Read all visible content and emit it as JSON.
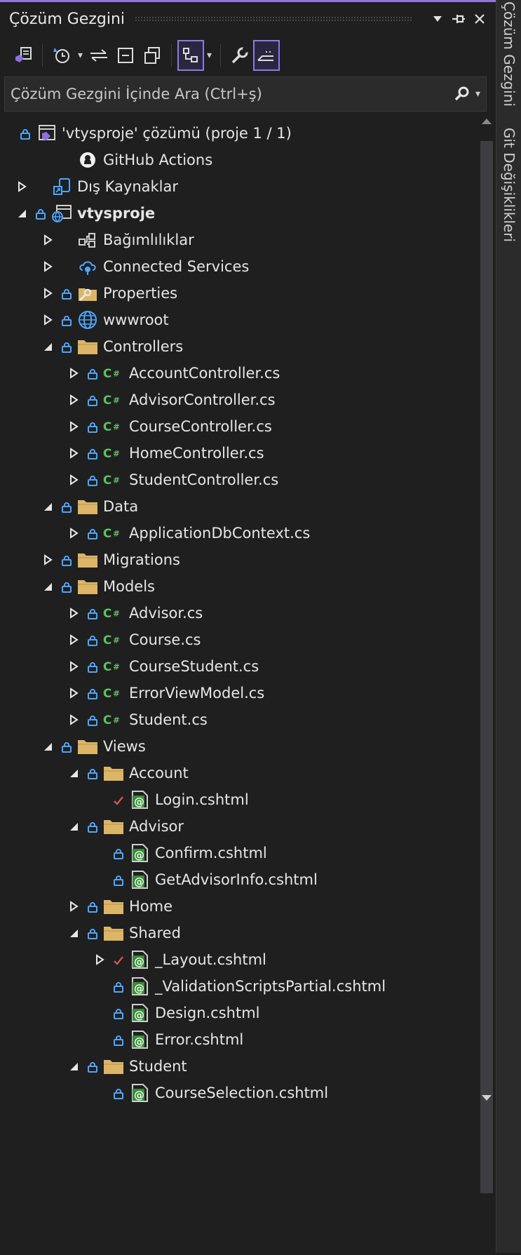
{
  "panel": {
    "title": "Çözüm Gezgini",
    "accent_color": "#9277d8",
    "title_icons": [
      "dropdown-icon",
      "pin-icon",
      "close-icon"
    ]
  },
  "toolbar": {
    "items": [
      "switch-views-icon",
      "history-icon",
      "sync-icon",
      "collapse-all-icon",
      "show-all-files-icon",
      "preview-icon",
      "properties-icon",
      "pending-changes-filter-icon"
    ]
  },
  "search": {
    "placeholder": "Çözüm Gezgini İçinde Ara (Ctrl+ş)"
  },
  "side_tabs": [
    "Çözüm Gezgini",
    "Git Değişiklikleri"
  ],
  "tree": [
    {
      "label": "'vtysproje' çözümü (proje 1 / 1)",
      "depth": 0,
      "expander": "none",
      "lock": true,
      "icon": "solution-icon"
    },
    {
      "label": "GitHub Actions",
      "depth": 1,
      "expander": "none",
      "lock": false,
      "icon": "github-icon"
    },
    {
      "label": "Dış Kaynaklar",
      "depth": 0,
      "expander": "collapsed",
      "lock": false,
      "icon": "external-sources-icon"
    },
    {
      "label": "vtysproje",
      "depth": 0,
      "expander": "expanded",
      "lock": true,
      "icon": "web-project-icon",
      "bold": true
    },
    {
      "label": "Bağımlılıklar",
      "depth": 1,
      "expander": "collapsed",
      "lock": false,
      "icon": "dependencies-icon"
    },
    {
      "label": "Connected Services",
      "depth": 1,
      "expander": "collapsed",
      "lock": false,
      "icon": "connected-services-icon"
    },
    {
      "label": "Properties",
      "depth": 1,
      "expander": "collapsed",
      "lock": true,
      "icon": "properties-folder-icon"
    },
    {
      "label": "wwwroot",
      "depth": 1,
      "expander": "collapsed",
      "lock": true,
      "icon": "globe-icon"
    },
    {
      "label": "Controllers",
      "depth": 1,
      "expander": "expanded",
      "lock": true,
      "icon": "folder-icon"
    },
    {
      "label": "AccountController.cs",
      "depth": 2,
      "expander": "collapsed",
      "lock": true,
      "icon": "csharp-icon"
    },
    {
      "label": "AdvisorController.cs",
      "depth": 2,
      "expander": "collapsed",
      "lock": true,
      "icon": "csharp-icon"
    },
    {
      "label": "CourseController.cs",
      "depth": 2,
      "expander": "collapsed",
      "lock": true,
      "icon": "csharp-icon"
    },
    {
      "label": "HomeController.cs",
      "depth": 2,
      "expander": "collapsed",
      "lock": true,
      "icon": "csharp-icon"
    },
    {
      "label": "StudentController.cs",
      "depth": 2,
      "expander": "collapsed",
      "lock": true,
      "icon": "csharp-icon"
    },
    {
      "label": "Data",
      "depth": 1,
      "expander": "expanded",
      "lock": true,
      "icon": "folder-icon"
    },
    {
      "label": "ApplicationDbContext.cs",
      "depth": 2,
      "expander": "collapsed",
      "lock": true,
      "icon": "csharp-icon"
    },
    {
      "label": "Migrations",
      "depth": 1,
      "expander": "collapsed",
      "lock": true,
      "icon": "folder-icon"
    },
    {
      "label": "Models",
      "depth": 1,
      "expander": "expanded",
      "lock": true,
      "icon": "folder-icon"
    },
    {
      "label": "Advisor.cs",
      "depth": 2,
      "expander": "collapsed",
      "lock": true,
      "icon": "csharp-icon"
    },
    {
      "label": "Course.cs",
      "depth": 2,
      "expander": "collapsed",
      "lock": true,
      "icon": "csharp-icon"
    },
    {
      "label": "CourseStudent.cs",
      "depth": 2,
      "expander": "collapsed",
      "lock": true,
      "icon": "csharp-icon"
    },
    {
      "label": "ErrorViewModel.cs",
      "depth": 2,
      "expander": "collapsed",
      "lock": true,
      "icon": "csharp-icon"
    },
    {
      "label": "Student.cs",
      "depth": 2,
      "expander": "collapsed",
      "lock": true,
      "icon": "csharp-icon"
    },
    {
      "label": "Views",
      "depth": 1,
      "expander": "expanded",
      "lock": true,
      "icon": "folder-icon"
    },
    {
      "label": "Account",
      "depth": 2,
      "expander": "expanded",
      "lock": true,
      "icon": "folder-icon"
    },
    {
      "label": "Login.cshtml",
      "depth": 3,
      "expander": "none",
      "lock": false,
      "check": true,
      "icon": "razor-icon"
    },
    {
      "label": "Advisor",
      "depth": 2,
      "expander": "expanded",
      "lock": true,
      "icon": "folder-icon"
    },
    {
      "label": "Confirm.cshtml",
      "depth": 3,
      "expander": "none",
      "lock": true,
      "icon": "razor-icon"
    },
    {
      "label": "GetAdvisorInfo.cshtml",
      "depth": 3,
      "expander": "none",
      "lock": true,
      "icon": "razor-icon"
    },
    {
      "label": "Home",
      "depth": 2,
      "expander": "collapsed",
      "lock": true,
      "icon": "folder-icon"
    },
    {
      "label": "Shared",
      "depth": 2,
      "expander": "expanded",
      "lock": true,
      "icon": "folder-icon"
    },
    {
      "label": "_Layout.cshtml",
      "depth": 3,
      "expander": "collapsed",
      "lock": false,
      "check": true,
      "icon": "razor-icon"
    },
    {
      "label": "_ValidationScriptsPartial.cshtml",
      "depth": 3,
      "expander": "none",
      "lock": true,
      "icon": "razor-icon"
    },
    {
      "label": "Design.cshtml",
      "depth": 3,
      "expander": "none",
      "lock": true,
      "icon": "razor-icon"
    },
    {
      "label": "Error.cshtml",
      "depth": 3,
      "expander": "none",
      "lock": true,
      "icon": "razor-icon"
    },
    {
      "label": "Student",
      "depth": 2,
      "expander": "expanded",
      "lock": true,
      "icon": "folder-icon"
    },
    {
      "label": "CourseSelection.cshtml",
      "depth": 3,
      "expander": "none",
      "lock": true,
      "icon": "razor-icon"
    }
  ]
}
